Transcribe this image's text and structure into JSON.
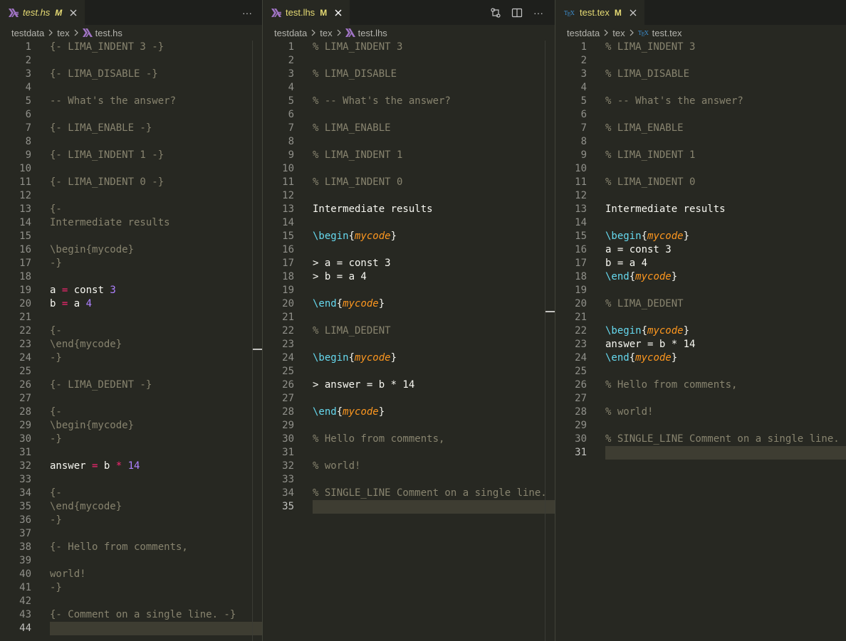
{
  "panes": {
    "hs": {
      "tab": {
        "icon": "haskell-icon",
        "title": "test.hs",
        "modified": "M"
      },
      "breadcrumb": [
        "testdata",
        "tex",
        "test.hs"
      ],
      "active_line": 44,
      "lines": [
        [
          [
            "c",
            "{- LIMA_INDENT 3 -}"
          ]
        ],
        [],
        [
          [
            "c",
            "{- LIMA_DISABLE -}"
          ]
        ],
        [],
        [
          [
            "c",
            "-- What's the answer?"
          ]
        ],
        [],
        [
          [
            "c",
            "{- LIMA_ENABLE -}"
          ]
        ],
        [],
        [
          [
            "c",
            "{- LIMA_INDENT 1 -}"
          ]
        ],
        [],
        [
          [
            "c",
            "{- LIMA_INDENT 0 -}"
          ]
        ],
        [],
        [
          [
            "c",
            "{-"
          ]
        ],
        [
          [
            "c",
            "Intermediate results"
          ]
        ],
        [],
        [
          [
            "c",
            "\\begin{mycode}"
          ]
        ],
        [
          [
            "c",
            "-}"
          ]
        ],
        [],
        [
          [
            "p",
            "a "
          ],
          [
            "o",
            "="
          ],
          [
            "p",
            " const "
          ],
          [
            "n",
            "3"
          ]
        ],
        [
          [
            "p",
            "b "
          ],
          [
            "o",
            "="
          ],
          [
            "p",
            " a "
          ],
          [
            "n",
            "4"
          ]
        ],
        [],
        [
          [
            "c",
            "{-"
          ]
        ],
        [
          [
            "c",
            "\\end{mycode}"
          ]
        ],
        [
          [
            "c",
            "-}"
          ]
        ],
        [],
        [
          [
            "c",
            "{- LIMA_DEDENT -}"
          ]
        ],
        [],
        [
          [
            "c",
            "{-"
          ]
        ],
        [
          [
            "c",
            "\\begin{mycode}"
          ]
        ],
        [
          [
            "c",
            "-}"
          ]
        ],
        [],
        [
          [
            "p",
            "answer "
          ],
          [
            "o",
            "="
          ],
          [
            "p",
            " b "
          ],
          [
            "o",
            "*"
          ],
          [
            "p",
            " "
          ],
          [
            "n",
            "14"
          ]
        ],
        [],
        [
          [
            "c",
            "{-"
          ]
        ],
        [
          [
            "c",
            "\\end{mycode}"
          ]
        ],
        [
          [
            "c",
            "-}"
          ]
        ],
        [],
        [
          [
            "c",
            "{- Hello from comments,"
          ]
        ],
        [],
        [
          [
            "c",
            "world!"
          ]
        ],
        [
          [
            "c",
            "-}"
          ]
        ],
        [],
        [
          [
            "c",
            "{- Comment on a single line. -}"
          ]
        ],
        []
      ]
    },
    "lhs": {
      "tab": {
        "icon": "haskell-icon",
        "title": "test.lhs",
        "modified": "M"
      },
      "breadcrumb": [
        "testdata",
        "tex",
        "test.lhs"
      ],
      "active_line": 35,
      "lines": [
        [
          [
            "c",
            "% LIMA_INDENT 3"
          ]
        ],
        [],
        [
          [
            "c",
            "% LIMA_DISABLE"
          ]
        ],
        [],
        [
          [
            "c",
            "% -- What's the answer?"
          ]
        ],
        [],
        [
          [
            "c",
            "% LIMA_ENABLE"
          ]
        ],
        [],
        [
          [
            "c",
            "% LIMA_INDENT 1"
          ]
        ],
        [],
        [
          [
            "c",
            "% LIMA_INDENT 0"
          ]
        ],
        [],
        [
          [
            "p",
            "Intermediate results"
          ]
        ],
        [],
        [
          [
            "k",
            "\\begin"
          ],
          [
            "p",
            "{"
          ],
          [
            "a",
            "mycode"
          ],
          [
            "p",
            "}"
          ]
        ],
        [],
        [
          [
            "p",
            "> a = const 3"
          ]
        ],
        [
          [
            "p",
            "> b = a 4"
          ]
        ],
        [],
        [
          [
            "k",
            "\\end"
          ],
          [
            "p",
            "{"
          ],
          [
            "a",
            "mycode"
          ],
          [
            "p",
            "}"
          ]
        ],
        [],
        [
          [
            "c",
            "% LIMA_DEDENT"
          ]
        ],
        [],
        [
          [
            "k",
            "\\begin"
          ],
          [
            "p",
            "{"
          ],
          [
            "a",
            "mycode"
          ],
          [
            "p",
            "}"
          ]
        ],
        [],
        [
          [
            "p",
            "> answer = b * 14"
          ]
        ],
        [],
        [
          [
            "k",
            "\\end"
          ],
          [
            "p",
            "{"
          ],
          [
            "a",
            "mycode"
          ],
          [
            "p",
            "}"
          ]
        ],
        [],
        [
          [
            "c",
            "% Hello from comments,"
          ]
        ],
        [],
        [
          [
            "c",
            "% world!"
          ]
        ],
        [],
        [
          [
            "c",
            "% SINGLE_LINE Comment on a single line."
          ]
        ],
        []
      ]
    },
    "tex": {
      "tab": {
        "icon": "tex-icon",
        "title": "test.tex",
        "modified": "M"
      },
      "breadcrumb": [
        "testdata",
        "tex",
        "test.tex"
      ],
      "active_line": 31,
      "lines": [
        [
          [
            "c",
            "% LIMA_INDENT 3"
          ]
        ],
        [],
        [
          [
            "c",
            "% LIMA_DISABLE"
          ]
        ],
        [],
        [
          [
            "c",
            "% -- What's the answer?"
          ]
        ],
        [],
        [
          [
            "c",
            "% LIMA_ENABLE"
          ]
        ],
        [],
        [
          [
            "c",
            "% LIMA_INDENT 1"
          ]
        ],
        [],
        [
          [
            "c",
            "% LIMA_INDENT 0"
          ]
        ],
        [],
        [
          [
            "p",
            "Intermediate results"
          ]
        ],
        [],
        [
          [
            "k",
            "\\begin"
          ],
          [
            "p",
            "{"
          ],
          [
            "a",
            "mycode"
          ],
          [
            "p",
            "}"
          ]
        ],
        [
          [
            "p",
            "a = const 3"
          ]
        ],
        [
          [
            "p",
            "b = a 4"
          ]
        ],
        [
          [
            "k",
            "\\end"
          ],
          [
            "p",
            "{"
          ],
          [
            "a",
            "mycode"
          ],
          [
            "p",
            "}"
          ]
        ],
        [],
        [
          [
            "c",
            "% LIMA_DEDENT"
          ]
        ],
        [],
        [
          [
            "k",
            "\\begin"
          ],
          [
            "p",
            "{"
          ],
          [
            "a",
            "mycode"
          ],
          [
            "p",
            "}"
          ]
        ],
        [
          [
            "p",
            "answer = b * 14"
          ]
        ],
        [
          [
            "k",
            "\\end"
          ],
          [
            "p",
            "{"
          ],
          [
            "a",
            "mycode"
          ],
          [
            "p",
            "}"
          ]
        ],
        [],
        [
          [
            "c",
            "% Hello from comments,"
          ]
        ],
        [],
        [
          [
            "c",
            "% world!"
          ]
        ],
        [],
        [
          [
            "c",
            "% SINGLE_LINE Comment on a single line."
          ]
        ],
        []
      ]
    }
  },
  "actions": {
    "more_label": "···"
  },
  "colors": {
    "background": "#272822",
    "comment": "#88846f",
    "keyword": "#66d9ef",
    "argument": "#fd971f",
    "operator": "#f92672",
    "number": "#ae81ff",
    "modified": "#e6db74"
  }
}
